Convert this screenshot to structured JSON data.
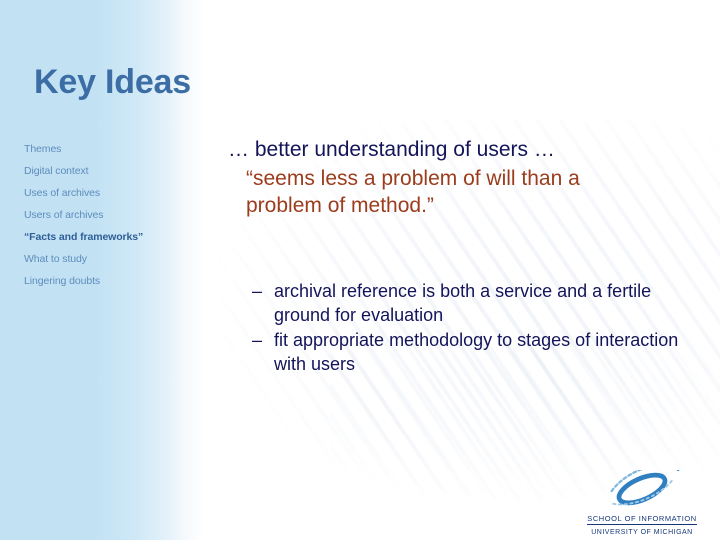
{
  "slide": {
    "title": "Key Ideas"
  },
  "sidebar": {
    "items": [
      {
        "label": "Themes",
        "current": false
      },
      {
        "label": "Digital context",
        "current": false
      },
      {
        "label": "Uses of archives",
        "current": false
      },
      {
        "label": "Users of archives",
        "current": false
      },
      {
        "label": "“Facts and frameworks”",
        "current": true
      },
      {
        "label": "What to study",
        "current": false
      },
      {
        "label": "Lingering doubts",
        "current": false
      }
    ]
  },
  "body": {
    "lead": "…  better understanding of users …",
    "quote_line1": "“seems less a problem of will than a",
    "quote_line2": "problem of method.”",
    "bullets": [
      {
        "marker": "–",
        "text": "archival reference is both a service and a fertile ground for evaluation"
      },
      {
        "marker": "–",
        "text": "fit appropriate methodology to stages of interaction with users"
      }
    ]
  },
  "logo": {
    "mark": "si-swoosh-icon",
    "school": "SCHOOL OF INFORMATION",
    "university": "UNIVERSITY OF MICHIGAN"
  },
  "colors": {
    "title": "#3c6ea5",
    "sidebar_text": "#5e8cbd",
    "sidebar_current": "#2f5e96",
    "lead_text": "#14145a",
    "quote_text": "#9c3c1c",
    "logo_text": "#16387a",
    "bg_left": "#c2e2f4",
    "bg_right": "#ffffff"
  }
}
